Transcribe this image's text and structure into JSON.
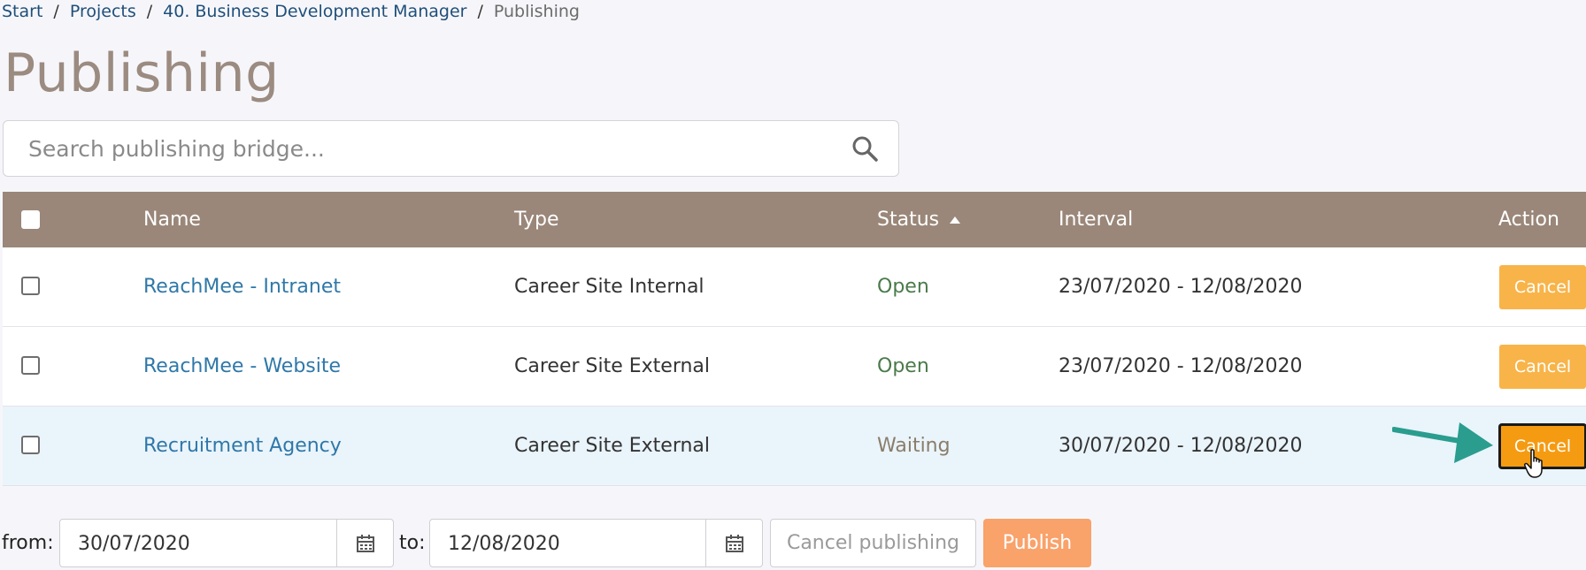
{
  "breadcrumb": {
    "items": [
      "Start",
      "Projects",
      "40. Business Development Manager"
    ],
    "current": "Publishing",
    "separator": "/"
  },
  "page": {
    "title": "Publishing"
  },
  "search": {
    "placeholder": "Search publishing bridge...",
    "icon": "search-icon"
  },
  "table": {
    "headers": {
      "name": "Name",
      "type": "Type",
      "status": "Status",
      "interval": "Interval",
      "action": "Action"
    },
    "sort": {
      "column": "Status",
      "direction": "ascending"
    },
    "rows": [
      {
        "name": "ReachMee - Intranet",
        "type": "Career Site Internal",
        "status": "Open",
        "interval": "23/07/2020 - 12/08/2020",
        "action": "Cancel"
      },
      {
        "name": "ReachMee - Website",
        "type": "Career Site External",
        "status": "Open",
        "interval": "23/07/2020 - 12/08/2020",
        "action": "Cancel"
      },
      {
        "name": "Recruitment Agency",
        "type": "Career Site External",
        "status": "Waiting",
        "interval": "30/07/2020 - 12/08/2020",
        "action": "Cancel"
      }
    ]
  },
  "filter": {
    "from_label": "from:",
    "from_value": "30/07/2020",
    "to_label": "to:",
    "to_value": "12/08/2020",
    "cancel_publishing": "Cancel publishing",
    "publish": "Publish"
  },
  "colors": {
    "header_bg": "#9a8779",
    "cancel_btn": "#f8b449",
    "publish_btn": "#f9a26a",
    "link": "#2f78a8",
    "annotation_arrow": "#2a9d8f"
  }
}
